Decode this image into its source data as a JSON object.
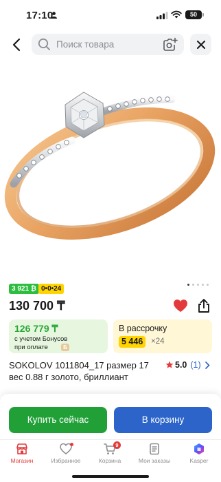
{
  "status_bar": {
    "time": "17:10",
    "battery": "50"
  },
  "search": {
    "placeholder": "Поиск товара"
  },
  "badges": {
    "bonus": "3 921 ₿",
    "installment": "0•0•24"
  },
  "carousel": {
    "total": 5,
    "active_index": 0
  },
  "product": {
    "price": "130 700 ₸",
    "title": "SOKOLOV 1011804_17 размер 17 вес 0.88 г золото, бриллиант",
    "rating_value": "5.0",
    "rating_count": "(1)"
  },
  "bonus_card": {
    "price": "126 779 ₸",
    "line1": "с учетом Бонусов",
    "line2": "при оплате",
    "coin_label": "Б"
  },
  "installment_card": {
    "title": "В рассрочку",
    "amount": "5 446",
    "months": "×24"
  },
  "actions": {
    "buy_now": "Купить сейчас",
    "add_to_cart": "В корзину"
  },
  "tab_bar": {
    "items": [
      {
        "label": "Магазин",
        "icon": "shop-icon",
        "active": true
      },
      {
        "label": "Избранное",
        "icon": "heart-icon",
        "active": false
      },
      {
        "label": "Корзина",
        "icon": "cart-icon",
        "active": false,
        "badge": "9"
      },
      {
        "label": "Мои заказы",
        "icon": "orders-icon",
        "active": false
      },
      {
        "label": "Kasper",
        "icon": "kasper-icon",
        "active": false
      }
    ]
  },
  "colors": {
    "accent_red": "#e33b3b",
    "buy_green": "#21a038",
    "cart_blue": "#2c64c9",
    "installment_yellow": "#ffd400",
    "bonus_green": "#2dbe3f"
  }
}
